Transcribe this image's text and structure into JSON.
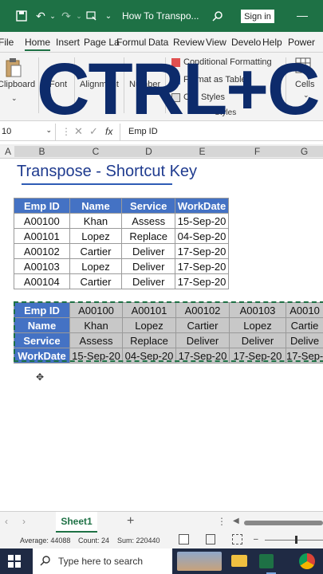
{
  "titlebar": {
    "doc_title": "How To Transpo...",
    "signin": "Sign in",
    "minimize": "—"
  },
  "tabs": [
    "File",
    "Home",
    "Insert",
    "Page La",
    "Formul",
    "Data",
    "Review",
    "View",
    "Develo",
    "Help",
    "Power"
  ],
  "ribbon": {
    "clipboard": "Clipboard",
    "font": "Font",
    "alignment": "Alignment",
    "number": "Number",
    "conditional_formatting": "Conditional Formatting",
    "format_table": "Format as Table",
    "cell_styles": "Cell Styles",
    "styles": "Styles",
    "cells": "Cells"
  },
  "overlay_text": "CTRL+C",
  "formula_bar": {
    "name_box": "10",
    "fx": "fx",
    "value": "Emp ID"
  },
  "columns": [
    "A",
    "B",
    "C",
    "D",
    "E",
    "F",
    "G"
  ],
  "sheet_title": "Transpose - Shortcut Key",
  "table1": {
    "headers": [
      "Emp ID",
      "Name",
      "Service",
      "WorkDate"
    ],
    "rows": [
      [
        "A00100",
        "Khan",
        "Assess",
        "15-Sep-20"
      ],
      [
        "A00101",
        "Lopez",
        "Replace",
        "04-Sep-20"
      ],
      [
        "A00102",
        "Cartier",
        "Deliver",
        "17-Sep-20"
      ],
      [
        "A00103",
        "Lopez",
        "Deliver",
        "17-Sep-20"
      ],
      [
        "A00104",
        "Cartier",
        "Deliver",
        "17-Sep-20"
      ]
    ]
  },
  "table2": {
    "rows": [
      [
        "Emp ID",
        "A00100",
        "A00101",
        "A00102",
        "A00103",
        "A0010"
      ],
      [
        "Name",
        "Khan",
        "Lopez",
        "Cartier",
        "Lopez",
        "Cartie"
      ],
      [
        "Service",
        "Assess",
        "Replace",
        "Deliver",
        "Deliver",
        "Delive"
      ],
      [
        "WorkDate",
        "15-Sep-20",
        "04-Sep-20",
        "17-Sep-20",
        "17-Sep-20",
        "17-Sep-"
      ]
    ]
  },
  "sheet_tab": "Sheet1",
  "add_sheet": "+",
  "status": {
    "average": "Average: 44088",
    "count": "Count: 24",
    "sum": "Sum: 220440"
  },
  "taskbar": {
    "search_placeholder": "Type here to search"
  },
  "colors": {
    "excel_green": "#1e7145",
    "header_blue": "#4472c4",
    "title_blue": "#1f3b8f"
  }
}
